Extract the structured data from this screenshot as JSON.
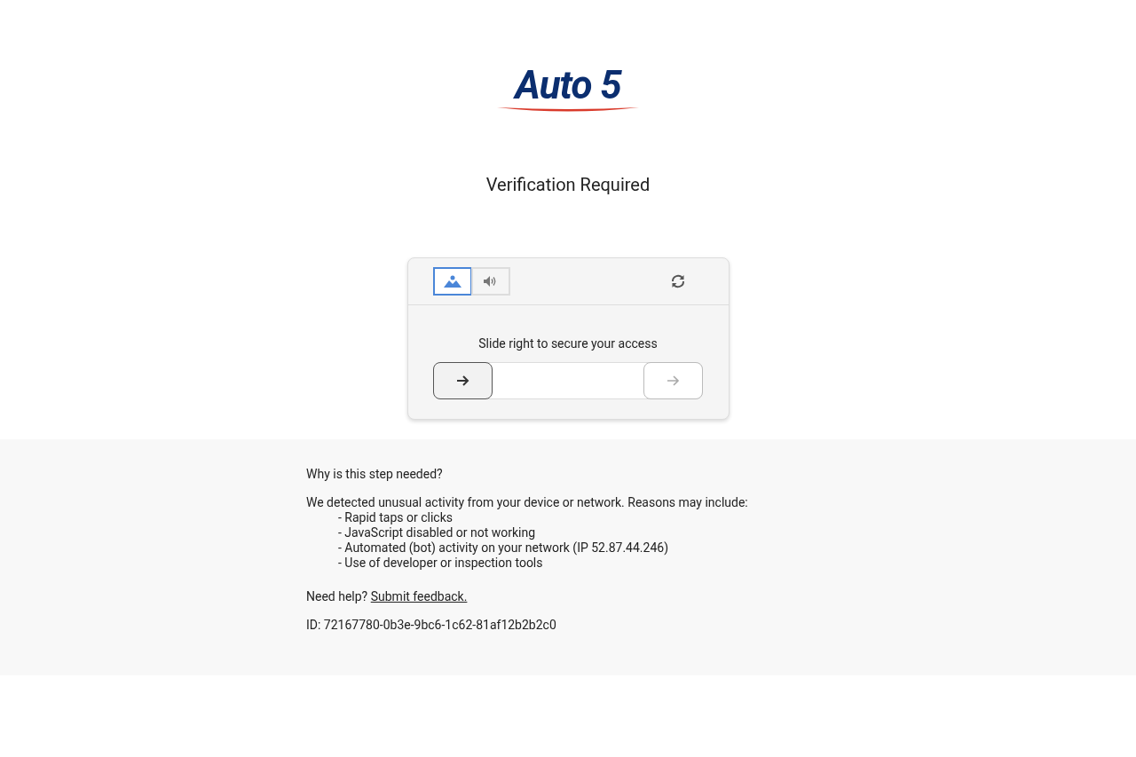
{
  "logo": {
    "text": "Auto 5"
  },
  "title": "Verification Required",
  "captcha": {
    "modes": [
      {
        "kind": "image",
        "selected": true
      },
      {
        "kind": "audio",
        "selected": false
      }
    ],
    "instruction": "Slide right to secure your access",
    "slider": {
      "level": 0
    }
  },
  "info": {
    "heading": "Why is this step needed?",
    "intro": "We detected unusual activity from your device or network. Reasons may include:",
    "reasons": [
      "- Rapid taps or clicks",
      "- JavaScript disabled or not working",
      "- Automated (bot) activity on your network (IP 52.87.44.246)",
      "- Use of developer or inspection tools"
    ],
    "help_prefix": "Need help?",
    "help_link": "Submit feedback.",
    "id": "ID: 72167780-0b3e-9bc6-1c62-81af12b2b2c0"
  }
}
